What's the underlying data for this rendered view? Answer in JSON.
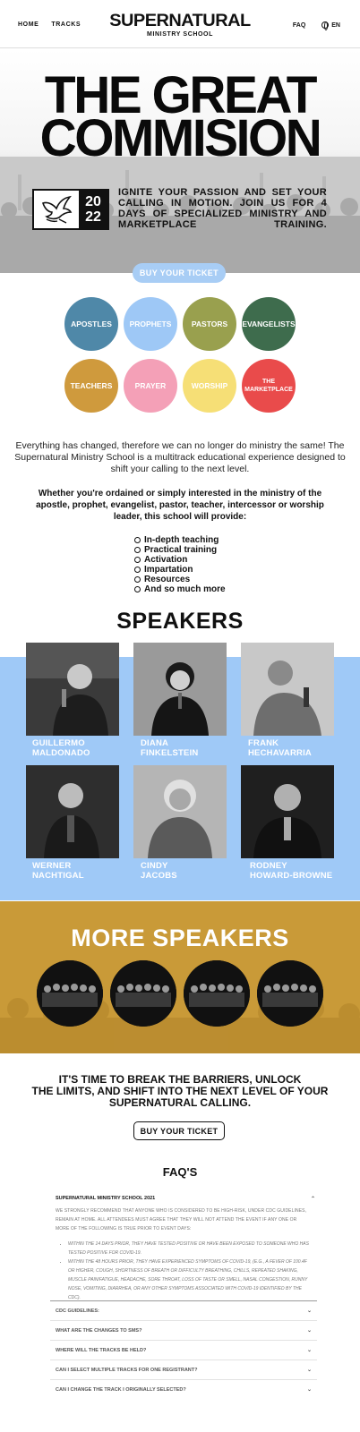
{
  "header": {
    "nav": [
      "HOME",
      "TRACKS"
    ],
    "logo_main": "SUPERNATURAL",
    "logo_sub": "MINISTRY SCHOOL",
    "faq": "FAQ",
    "lang": "EN"
  },
  "hero": {
    "title_line1": "THE GREAT",
    "title_line2": "COMMISION",
    "badge_year_top": "20",
    "badge_year_bottom": "22",
    "tagline": "IGNITE YOUR PASSION AND SET YOUR CALLING IN MOTION. JOIN US FOR 4 DAYS OF SPECIALIZED MINISTRY AND MARKETPLACE TRAINING.",
    "buy_label": "BUY YOUR TICKET"
  },
  "tracks": [
    {
      "label": "APOSTLES",
      "color": "#4f88a8"
    },
    {
      "label": "PROPHETS",
      "color": "#9ec8f6"
    },
    {
      "label": "PASTORS",
      "color": "#99a04e"
    },
    {
      "label": "EVANGELISTS",
      "color": "#3e6c4d"
    },
    {
      "label": "TEACHERS",
      "color": "#cf9a3d"
    },
    {
      "label": "PRAYER",
      "color": "#f4a0b7"
    },
    {
      "label": "WORSHIP",
      "color": "#f6df76"
    },
    {
      "label": "THE MARKETPLACE",
      "color": "#e94b4b"
    }
  ],
  "intro": {
    "paragraph": "Everything has changed, therefore we can no longer do ministry the same! The Supernatural Ministry School is a multitrack educational experience designed to shift your calling to the next level.",
    "ordained": "Whether you're ordained or simply interested in the ministry of the apostle, prophet, evangelist, pastor, teacher, intercessor or worship leader, this school will provide:",
    "list": [
      "In-depth teaching",
      "Practical training",
      "Activation",
      "Impartation",
      "Resources",
      "And so much more"
    ]
  },
  "speakers": {
    "title": "SPEAKERS",
    "people": [
      {
        "first": "GUILLERMO",
        "last": "MALDONADO"
      },
      {
        "first": "DIANA",
        "last": "FINKELSTEIN"
      },
      {
        "first": "FRANK",
        "last": "HECHAVARRIA"
      },
      {
        "first": "WERNER",
        "last": "NACHTIGAL"
      },
      {
        "first": "CINDY",
        "last": "JACOBS"
      },
      {
        "first": "RODNEY",
        "last": "HOWARD-BROWNE"
      }
    ]
  },
  "more_speakers": {
    "title": "MORE SPEAKERS"
  },
  "cta": {
    "line1": "IT'S TIME TO BREAK THE BARRIERS, UNLOCK",
    "line2": "THE LIMITS, AND SHIFT INTO THE NEXT LEVEL OF YOUR",
    "line3": "SUPERNATURAL CALLING.",
    "buy_label": "BUY YOUR TICKET"
  },
  "faq": {
    "title": "FAQ'S",
    "open_question": "SUPERNATURAL MINISTRY SCHOOL 2021",
    "open_answer": "WE STRONGLY RECOMMEND THAT ANYONE WHO IS CONSIDERED TO BE HIGH-RISK, UNDER CDC GUIDELINES, REMAIN AT HOME. ALL ATTENDEES MUST AGREE THAT THEY WILL NOT ATTEND THE EVENT IF ANY ONE OR MORE OF THE FOLLOWING IS TRUE PRIOR TO EVENT DAYS:",
    "bullets": [
      "WITHIN THE 14 DAYS PRIOR, THEY HAVE TESTED POSITIVE OR HAVE BEEN EXPOSED TO SOMEONE WHO HAS TESTED POSITIVE FOR COVID-19.",
      "WITHIN THE 48 HOURS PRIOR, THEY HAVE EXPERIENCED SYMPTOMS OF COVID-19, (E.G., A FEVER OF 100.4F OR HIGHER, COUGH, SHORTNESS OF BREATH OR DIFFICULTY BREATHING, CHILLS, REPEATED SHAKING, MUSCLE PAIN/FATIGUE, HEADACHE, SORE THROAT, LOSS OF TASTE OR SMELL, NASAL CONGESTION, RUNNY NOSE, VOMITING, DIARRHEA, OR ANY OTHER SYMPTOMS ASSOCIATED WITH COVID-19 IDENTIFIED BY THE CDC)."
    ],
    "questions": [
      "CDC GUIDELINES:",
      "WHAT ARE THE CHANGES TO SMS?",
      "WHERE WILL THE TRACKS BE HELD?",
      "CAN I SELECT MULTIPLE TRACKS FOR ONE REGISTRANT?",
      "CAN I CHANGE THE TRACK I ORIGINALLY SELECTED?"
    ]
  }
}
